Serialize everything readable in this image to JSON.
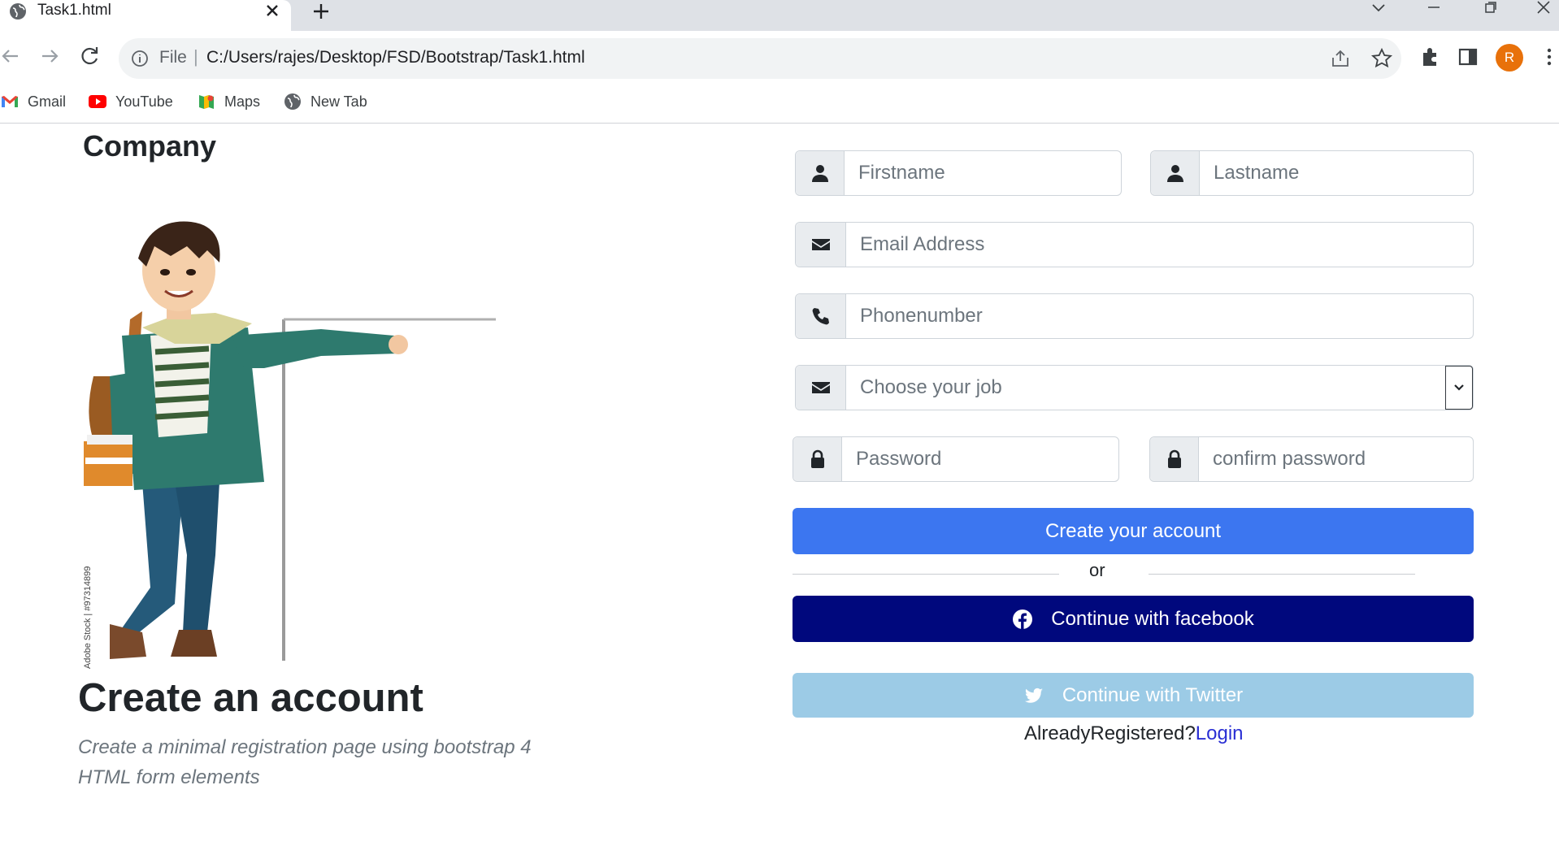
{
  "browser": {
    "tab_title": "Task1.html",
    "omnibox": {
      "scheme_label": "File",
      "separator": "|",
      "url": "C:/Users/rajes/Desktop/FSD/Bootstrap/Task1.html"
    },
    "profile_initial": "R",
    "bookmarks": [
      {
        "label": "Gmail",
        "icon": "gmail-icon"
      },
      {
        "label": "YouTube",
        "icon": "youtube-icon"
      },
      {
        "label": "Maps",
        "icon": "maps-icon"
      },
      {
        "label": "New Tab",
        "icon": "globe-icon"
      }
    ]
  },
  "page": {
    "brand": "Company",
    "hero": {
      "title": "Create an account",
      "subtitle_line1": "Create a minimal registration page using bootstrap 4",
      "subtitle_line2": "HTML form elements"
    },
    "form": {
      "firstname_placeholder": "Firstname",
      "lastname_placeholder": "Lastname",
      "email_placeholder": "Email Address",
      "phone_placeholder": "Phonenumber",
      "job_select_value": "Choose your job",
      "password_placeholder": "Password",
      "confirm_password_placeholder": "confirm password",
      "submit_label": "Create your account",
      "divider_text": "or",
      "facebook_label": "Continue with facebook",
      "twitter_label": "Continue with Twitter",
      "already_registered_text": "AlreadyRegistered?",
      "login_link": "Login"
    }
  },
  "colors": {
    "primary_button": "#3c76f0",
    "facebook_button": "#00087d",
    "twitter_button": "#9ccbe6",
    "login_link": "#2a2fd4",
    "avatar": "#e8710a"
  }
}
